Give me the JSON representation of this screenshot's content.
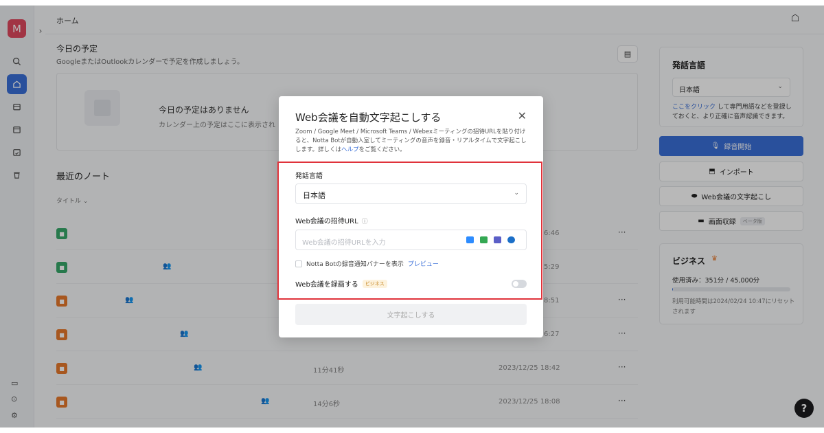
{
  "user": {
    "avatar_letter": "M"
  },
  "breadcrumb": "ホーム",
  "schedule": {
    "title": "今日の予定",
    "subtitle": "GoogleまたはOutlookカレンダーで予定を作成しましょう。",
    "empty_title": "今日の予定はありません",
    "empty_subtitle": "カレンダー上の予定はここに表示され"
  },
  "recent": {
    "title": "最近のノート",
    "column_title": "タイトル ⌄",
    "rows": [
      {
        "color": "green",
        "date": "6:46"
      },
      {
        "color": "green",
        "date": "5:29"
      },
      {
        "color": "orange",
        "date": "8:51"
      },
      {
        "color": "orange",
        "date": "6:27"
      },
      {
        "color": "orange",
        "duration": "11分41秒",
        "date": "2023/12/25 18:42"
      },
      {
        "color": "orange",
        "duration": "14分6秒",
        "date": "2023/12/25 18:08"
      }
    ]
  },
  "right_panel": {
    "lang_title": "発話言語",
    "lang_value": "日本語",
    "note_link": "ここをクリック",
    "note_text": " して専門用語などを登録しておくと、より正確に音声認識できます。",
    "record_btn": "録音開始",
    "import_btn": "インポート",
    "web_btn": "Web会議の文字起こし",
    "screen_btn": "画面収録",
    "beta": "ベータ版",
    "biz_title": "ビジネス",
    "biz_usage": "使用済み：351分 / 45,000分",
    "biz_usage_fraction": 0.0078,
    "biz_note": "利用可能時間は2024/02/24 10:47にリセットされます"
  },
  "modal": {
    "title": "Web会議を自動文字起こしする",
    "desc_1": "Zoom / Google Meet / Microsoft Teams / Webexミーティングの招待URLを貼り付けると、Notta Botが自動入室してミーティングの音声を録音・リアルタイムで文字起こしします。詳しくは",
    "desc_link": "ヘルプ",
    "desc_2": "をご覧ください。",
    "lang_label": "発話言語",
    "lang_value": "日本語",
    "url_label": "Web会議の招待URL",
    "url_placeholder": "Web会議の招待URLを入力",
    "banner_label": "Notta Botの録音通知バナーを表示",
    "banner_link": "プレビュー",
    "record_label": "Web会議を録画する",
    "record_tag": "ビジネス",
    "submit": "文字起こしする"
  },
  "colors": {
    "accent": "#3a6fd8",
    "highlight": "#e0333b",
    "avatar": "#e0495f"
  }
}
